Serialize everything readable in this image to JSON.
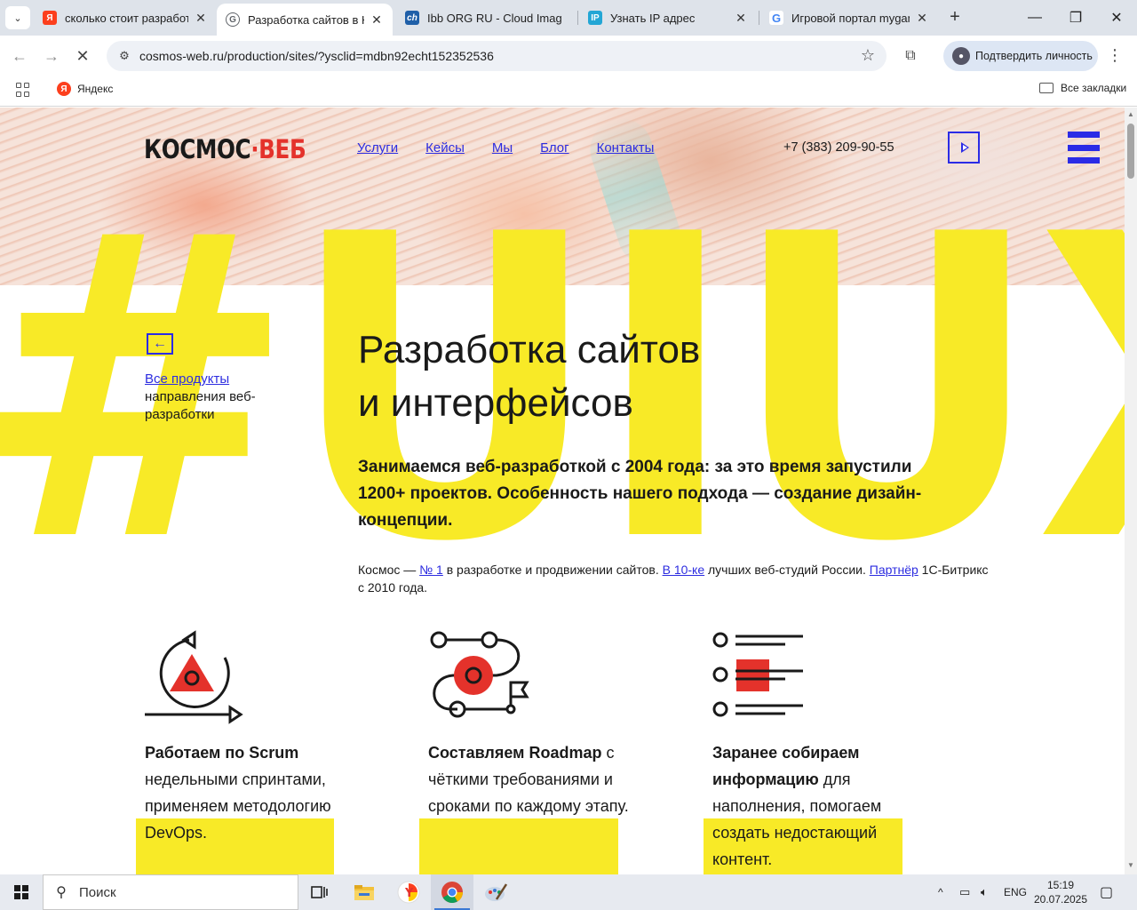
{
  "browser": {
    "tabs": [
      {
        "title": "сколько стоит разработк",
        "favicon": "Я",
        "favicon_color": "#fc3f1d",
        "active": false
      },
      {
        "title": "Разработка сайтов в Но",
        "favicon": "G",
        "favicon_color": "#5f6368",
        "active": true
      },
      {
        "title": "Ibb ORG RU - Cloud Imag",
        "favicon": "ch",
        "favicon_color": "#1f5fa8",
        "active": false
      },
      {
        "title": "Узнать IP адрес",
        "favicon": "IP",
        "favicon_color": "#23a6d5",
        "active": false
      },
      {
        "title": "Игровой портал mygam",
        "favicon": "G",
        "favicon_color": "#4285f4",
        "active": false
      }
    ],
    "address": "cosmos-web.ru/production/sites/?ysclid=mdbn92echt152352536",
    "profile_label": "Подтвердить личность",
    "bookmarks": {
      "yandex": "Яндекс",
      "all": "Все закладки"
    }
  },
  "site": {
    "logo": {
      "part1": "КОСМОС",
      "dot": "·",
      "part2": "ВЕБ"
    },
    "menu": [
      "Услуги",
      "Кейсы",
      "Мы",
      "Блог",
      "Контакты"
    ],
    "phone": "+7 (383) 209-90-55",
    "bigtag": "#UIUX",
    "back": {
      "link": "Все продукты",
      "caption": "направления веб-разработки"
    },
    "title_line1": "Разработка сайтов",
    "title_line2": "и интерфейсов",
    "lead": "Занимаемся веб-разработкой с 2004 года: за это время запустили 1200+ проектов. Особенность нашего подхода — создание дизайн-концепции.",
    "note": {
      "t1": "Космос — ",
      "l1": "№ 1",
      "t2": " в разработке и продвижении сайтов. ",
      "l2": "В 10-ке",
      "t3": " лучших веб-студий России. ",
      "l3": "Партнёр",
      "t4": " 1С-Битрикс с 2010 года."
    },
    "features": [
      {
        "bold": "Работаем по Scrum",
        "rest": " недельными спринтами, применяем методологию DevOps."
      },
      {
        "bold": "Составляем Roadmap",
        "rest": " с чёткими требованиями и сроками по каждому этапу."
      },
      {
        "bold": "Заранее собираем информацию",
        "rest": " для наполнения, помогаем создать недостающий контент."
      }
    ],
    "colors": {
      "accent_blue": "#2b2be6",
      "accent_red": "#e4322b",
      "highlight_yellow": "#f8ea27"
    }
  },
  "taskbar": {
    "search": "Поиск",
    "lang": "ENG",
    "time": "15:19",
    "date": "20.07.2025"
  }
}
